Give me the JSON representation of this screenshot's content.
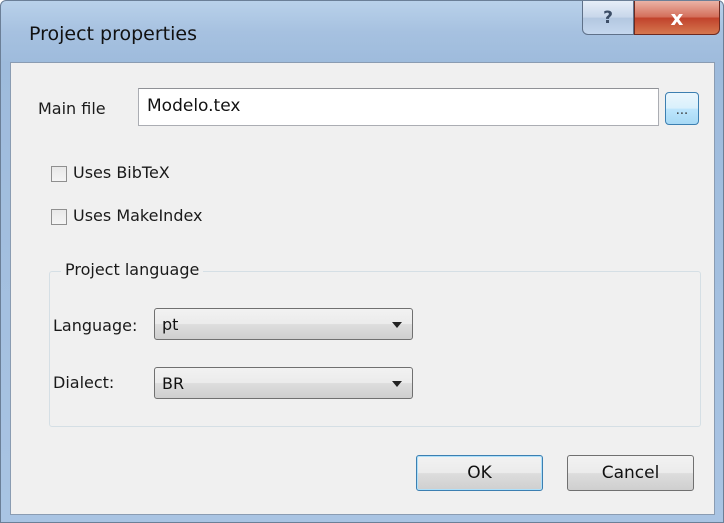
{
  "window": {
    "title": "Project properties",
    "help_glyph": "?",
    "close_glyph": "x"
  },
  "main_file": {
    "label": "Main file",
    "value": "Modelo.tex",
    "browse_label": "..."
  },
  "options": {
    "uses_bibtex": {
      "label": "Uses BibTeX",
      "checked": false
    },
    "uses_makeindex": {
      "label": "Uses MakeIndex",
      "checked": false
    }
  },
  "project_language": {
    "group_label": "Project language",
    "language_label": "Language:",
    "language_value": "pt",
    "dialect_label": "Dialect:",
    "dialect_value": "BR"
  },
  "buttons": {
    "ok": "OK",
    "cancel": "Cancel"
  }
}
